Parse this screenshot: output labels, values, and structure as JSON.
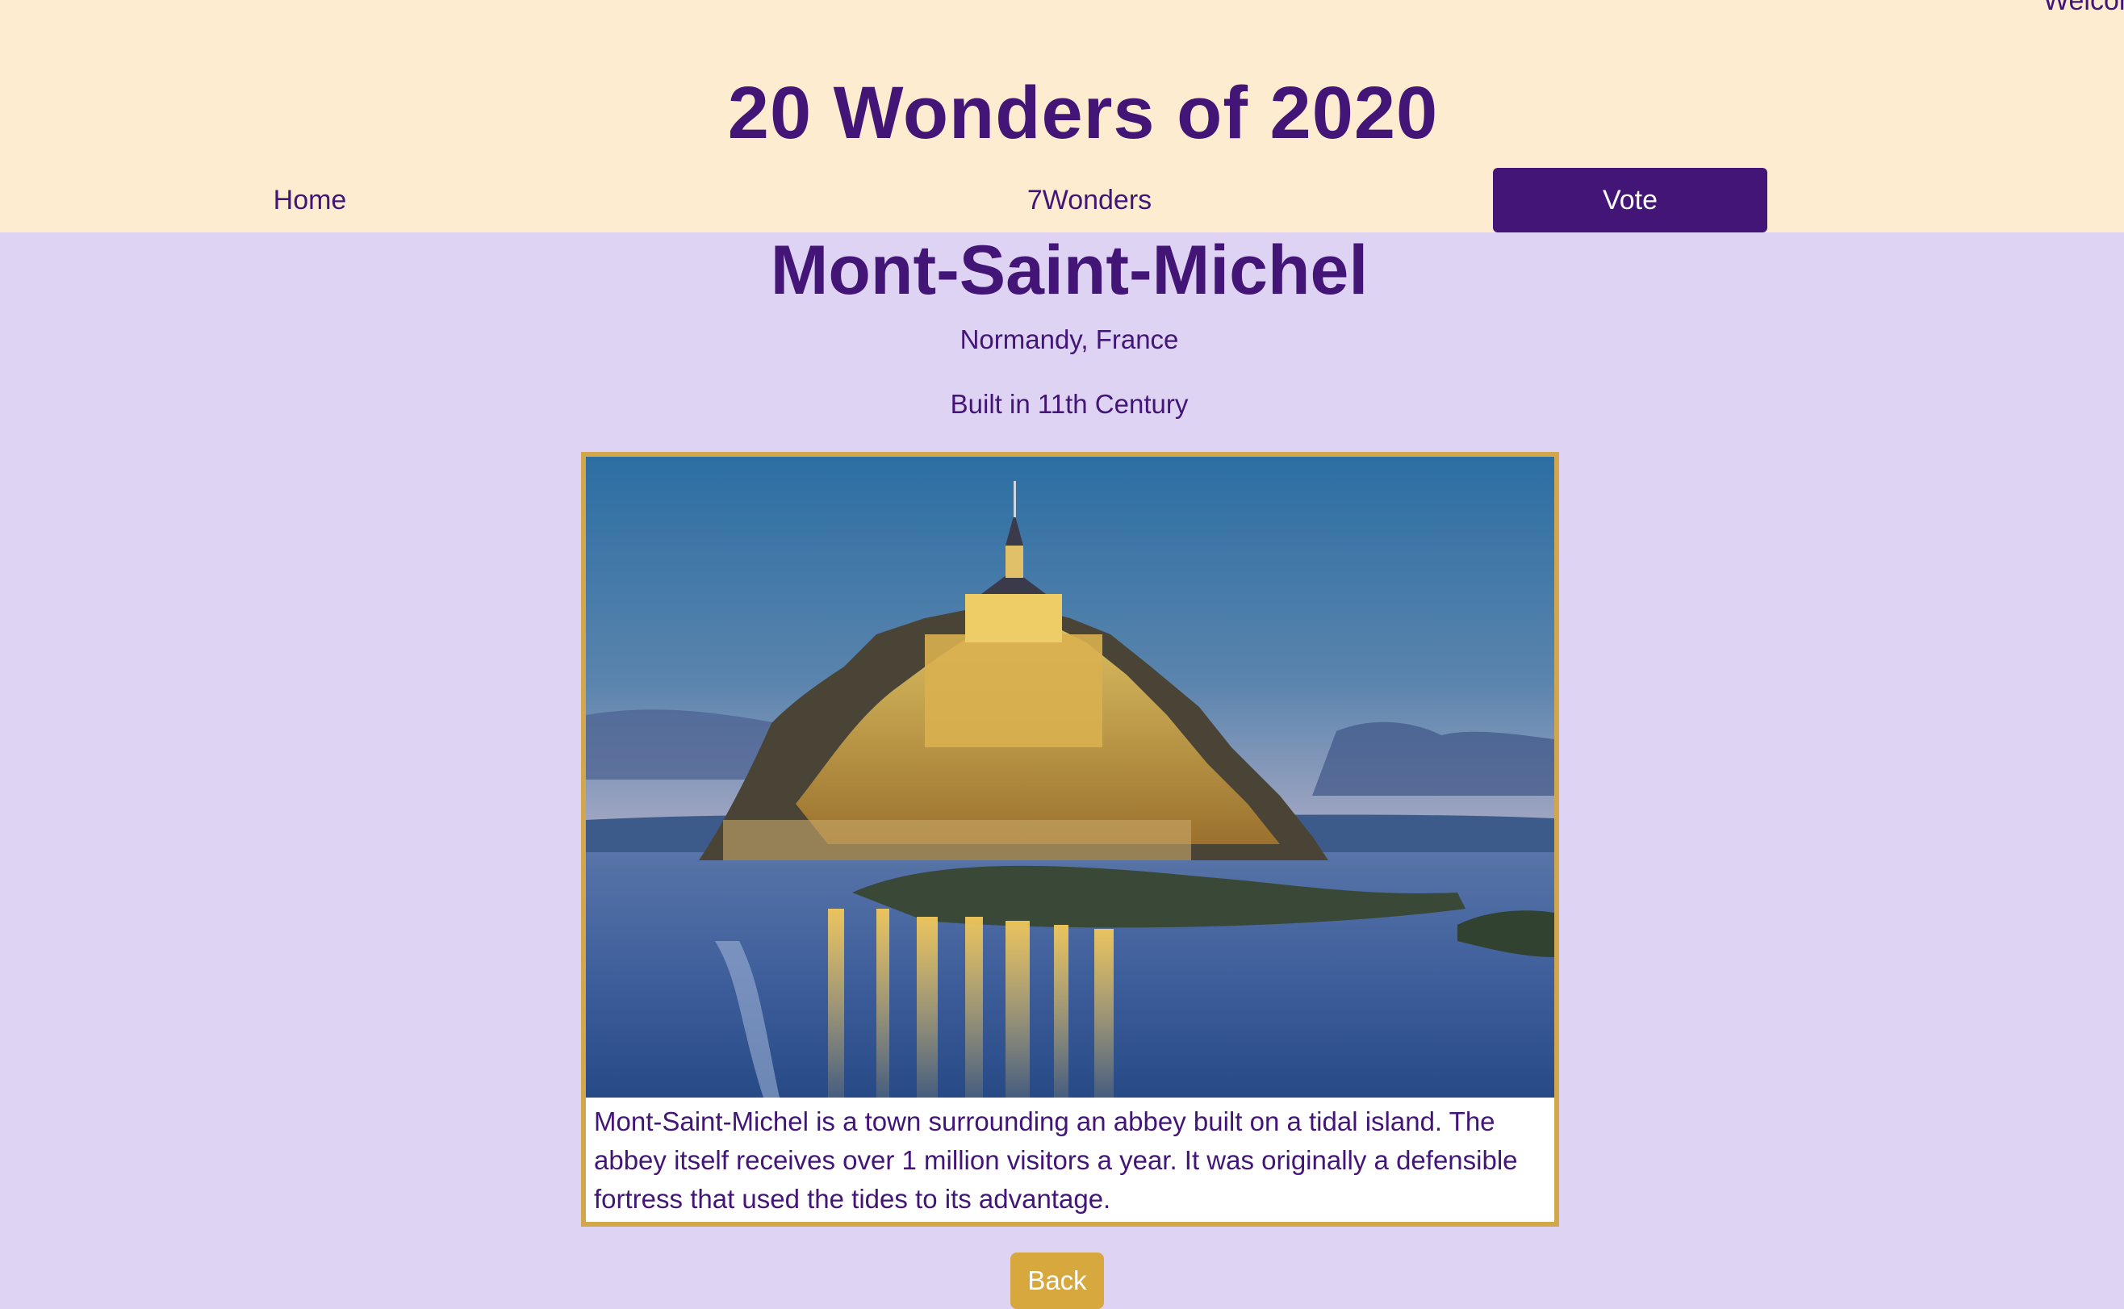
{
  "header": {
    "welcome_text": "Welcome",
    "site_title": "20 Wonders of 2020"
  },
  "nav": {
    "home": "Home",
    "seven_wonders": "7Wonders",
    "vote": "Vote"
  },
  "wonder": {
    "name": "Mont-Saint-Michel",
    "location": "Normandy, France",
    "built": "Built in 11th Century",
    "description": "Mont-Saint-Michel is a town surrounding an abbey built on a tidal island. The abbey itself receives over 1 million visitors a year. It was originally a defensible fortress that used the tides to its advantage."
  },
  "actions": {
    "back": "Back"
  },
  "colors": {
    "header_bg": "#fdecd0",
    "page_bg": "#ded3f2",
    "brand_purple": "#421577",
    "card_border": "#d2a74b",
    "back_button": "#d6a83d"
  }
}
